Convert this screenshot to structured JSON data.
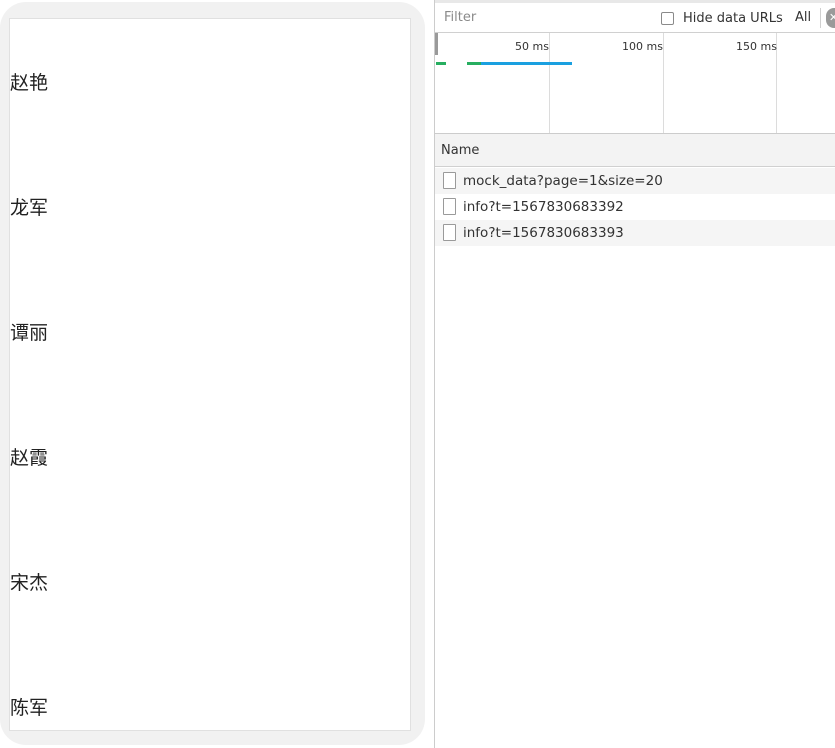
{
  "preview": {
    "names": [
      "赵艳",
      "龙军",
      "谭丽",
      "赵霞",
      "宋杰",
      "陈军"
    ]
  },
  "toolbar": {
    "filter_placeholder": "Filter",
    "hide_data_urls_label": "Hide data URLs",
    "hide_data_urls_checked": false,
    "type_filter_label": "All"
  },
  "overview": {
    "tick_labels": [
      "50 ms",
      "100 ms",
      "150 ms"
    ],
    "colors": {
      "green": "#27ae60",
      "blue": "#1aa0e0"
    }
  },
  "table": {
    "columns": [
      "Name"
    ],
    "requests": [
      {
        "name": "mock_data?page=1&size=20"
      },
      {
        "name": "info?t=1567830683392"
      },
      {
        "name": "info?t=1567830683393"
      }
    ]
  }
}
